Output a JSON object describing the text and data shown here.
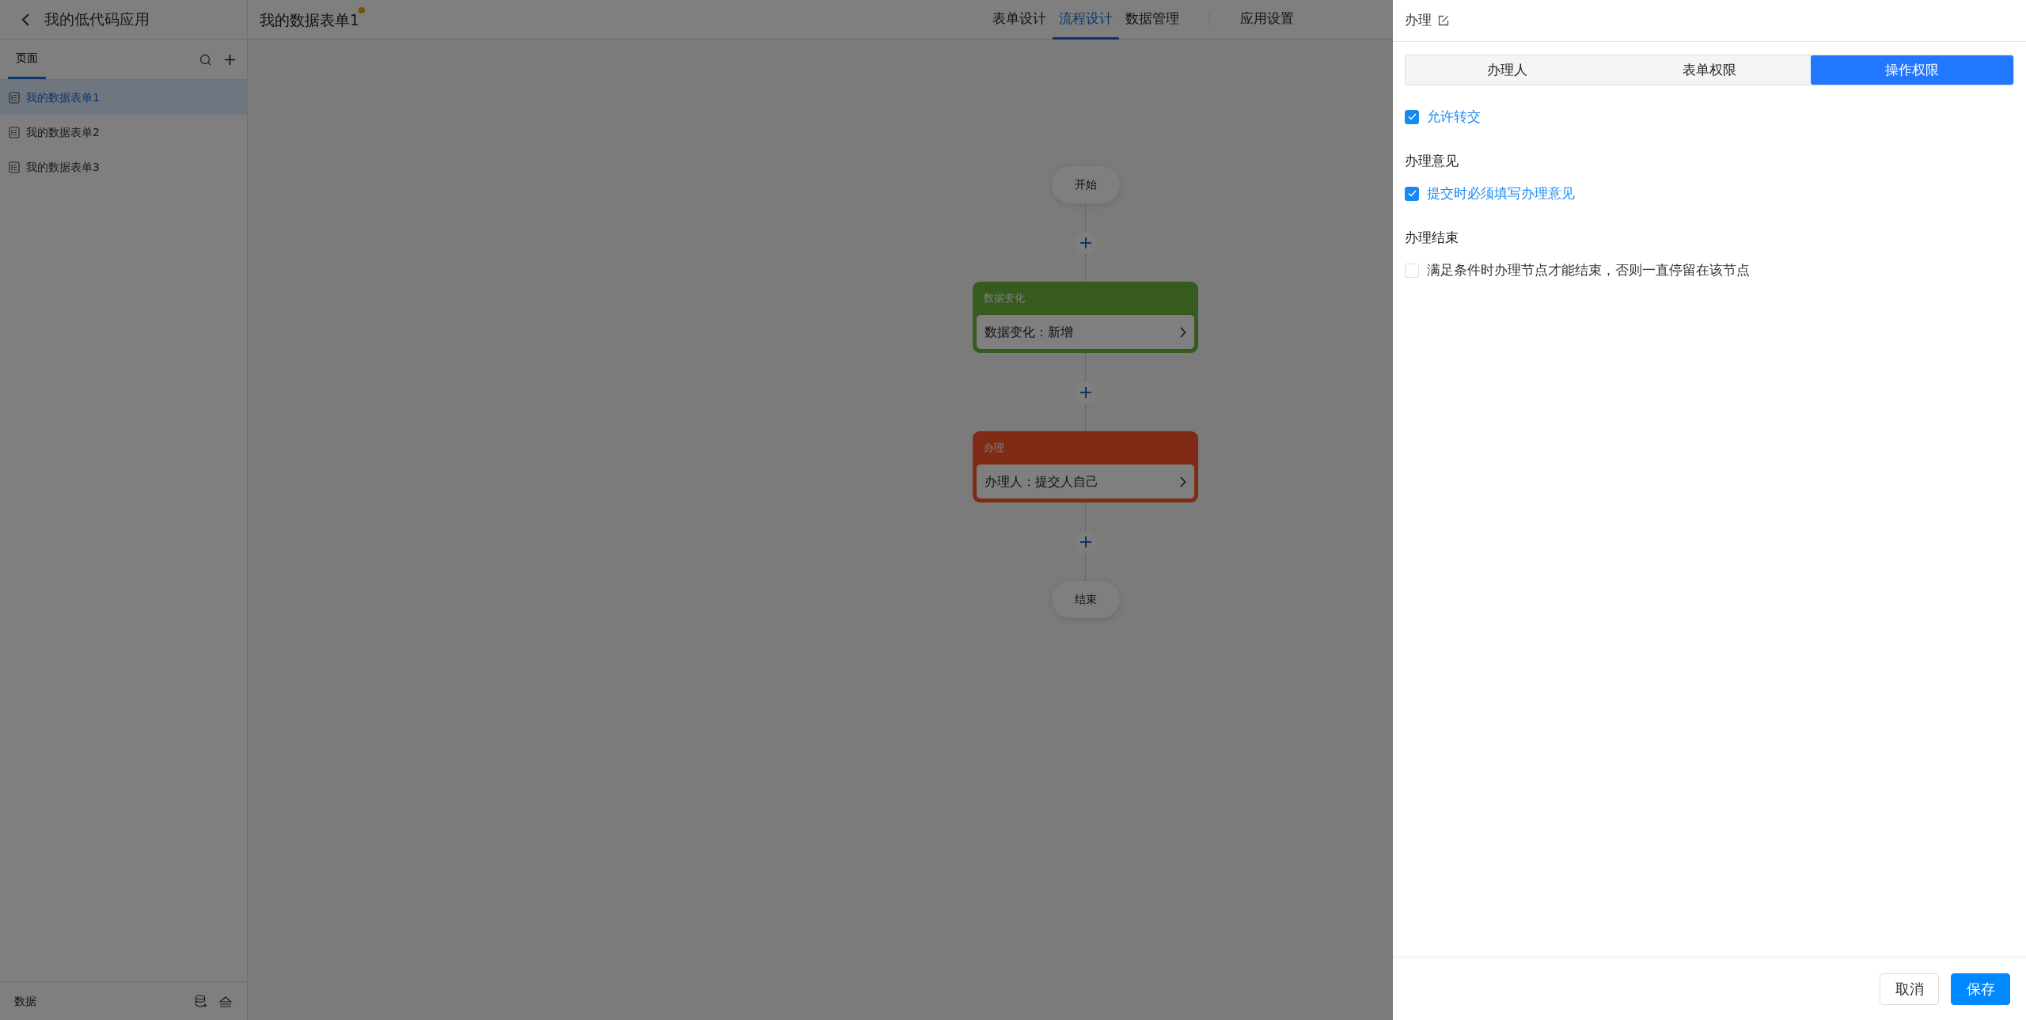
{
  "app": {
    "title": "我的低代码应用"
  },
  "sidebar": {
    "tabs": [
      {
        "label": "页面",
        "selected": true
      }
    ],
    "items": [
      {
        "label": "我的数据表单1",
        "selected": true
      },
      {
        "label": "我的数据表单2",
        "selected": false
      },
      {
        "label": "我的数据表单3",
        "selected": false
      }
    ],
    "footer": {
      "label": "数据"
    }
  },
  "header": {
    "title": "我的数据表单1",
    "unsaved": true,
    "tabs": [
      {
        "label": "表单设计",
        "selected": false
      },
      {
        "label": "流程设计",
        "selected": true
      },
      {
        "label": "数据管理",
        "selected": false
      }
    ],
    "settings": {
      "label": "应用设置"
    }
  },
  "flow": {
    "nodes": [
      {
        "kind": "terminal",
        "label": "开始"
      },
      {
        "kind": "card",
        "title": "数据变化",
        "summary": "数据变化：新增",
        "color": "#375a1e"
      },
      {
        "kind": "card",
        "title": "办理",
        "summary": "办理人：提交人自己",
        "color": "#7f2b16"
      },
      {
        "kind": "terminal",
        "label": "结束"
      }
    ]
  },
  "drawer": {
    "title": "办理",
    "tabs": [
      {
        "label": "办理人",
        "selected": false
      },
      {
        "label": "表单权限",
        "selected": false
      },
      {
        "label": "操作权限",
        "selected": true
      }
    ],
    "options": [
      {
        "kind": "check",
        "label": "允许转交",
        "checked": true
      },
      {
        "kind": "heading",
        "label": "办理意见"
      },
      {
        "kind": "check",
        "label": "提交时必须填写办理意见",
        "checked": true
      },
      {
        "kind": "heading",
        "label": "办理结束"
      },
      {
        "kind": "check",
        "label": "满足条件时办理节点才能结束，否则一直停留在该节点",
        "checked": false
      }
    ],
    "buttons": [
      {
        "kind": "secondary",
        "label": "取消"
      },
      {
        "kind": "primary",
        "label": "保存"
      }
    ]
  }
}
